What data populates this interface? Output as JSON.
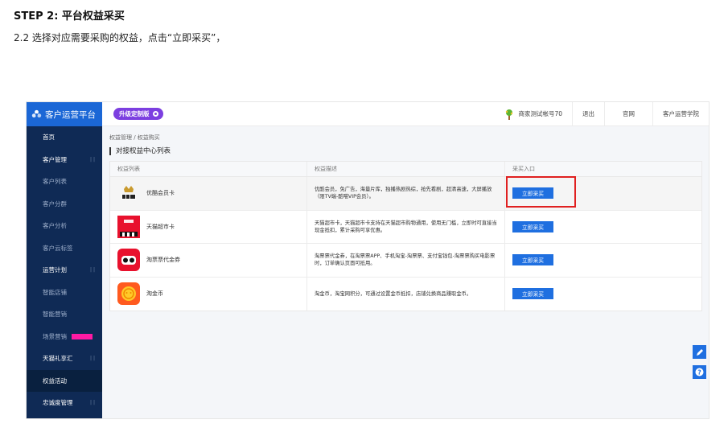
{
  "doc": {
    "step_title": "STEP 2: 平台权益采买",
    "step_sub": "2.2  选择对应需要采购的权益，点击“立即采买”，"
  },
  "sidebar": {
    "brand": "客户运营平台",
    "items": [
      {
        "label": "首页",
        "type": "parent"
      },
      {
        "label": "客户管理",
        "type": "parent",
        "chev": "| |"
      },
      {
        "label": "客户列表",
        "type": "child"
      },
      {
        "label": "客户分群",
        "type": "child"
      },
      {
        "label": "客户分析",
        "type": "child"
      },
      {
        "label": "客户云标签",
        "type": "child"
      },
      {
        "label": "运营计划",
        "type": "parent",
        "chev": "| |"
      },
      {
        "label": "智能店铺",
        "type": "child"
      },
      {
        "label": "智能营销",
        "type": "child"
      },
      {
        "label": "场景营销",
        "type": "child",
        "hot": true
      },
      {
        "label": "天猫礼享汇",
        "type": "parent",
        "chev": "| |"
      },
      {
        "label": "权益活动",
        "type": "active"
      },
      {
        "label": "忠诚度管理",
        "type": "parent",
        "chev": "| |"
      }
    ]
  },
  "topbar": {
    "upgrade_label": "升级定制版",
    "account": "商家测试帐号70",
    "logout": "退出",
    "official": "官网",
    "academy": "客户运营学院"
  },
  "breadcrumb": "权益管理 / 权益购买",
  "section_title": "对接权益中心列表",
  "table": {
    "headers": [
      "权益列表",
      "权益描述",
      "采买入口"
    ],
    "rows": [
      {
        "name": "优酷会员卡",
        "logo": "youku-logo",
        "desc": "优酷会员，免广告，海量片库，独播热剧热综，抢先看剧，超清高速，大屏播放（限TV端-酷喵VIP会员）。",
        "button": "立即采买"
      },
      {
        "name": "天猫超市卡",
        "logo": "tmall-logo",
        "desc": "天猫超市卡，天猫超市卡支持在天猫超市购物通用，使用无门槛，立即时可直接当现金抵扣，累计采购可享优惠。",
        "button": "立即采买"
      },
      {
        "name": "淘票票代金券",
        "logo": "taopiaopiao-logo",
        "desc": "淘票票代金券，在淘票票APP、手机淘宝-淘票票、支付宝钱包-淘票票购买电影票时，订单确认页面可抵用。",
        "button": "立即采买"
      },
      {
        "name": "淘金币",
        "logo": "taojinbi-logo",
        "desc": "淘金币，淘宝网积分，可通过设置金币抵扣，店铺兑换商品赚取金币。",
        "button": "立即采买"
      }
    ]
  },
  "colors": {
    "sidebar": "#0f2a55",
    "brand": "#1b67d6",
    "button": "#1f6fe0",
    "highlight": "#e02020",
    "upgrade": "#7c3fe0"
  }
}
